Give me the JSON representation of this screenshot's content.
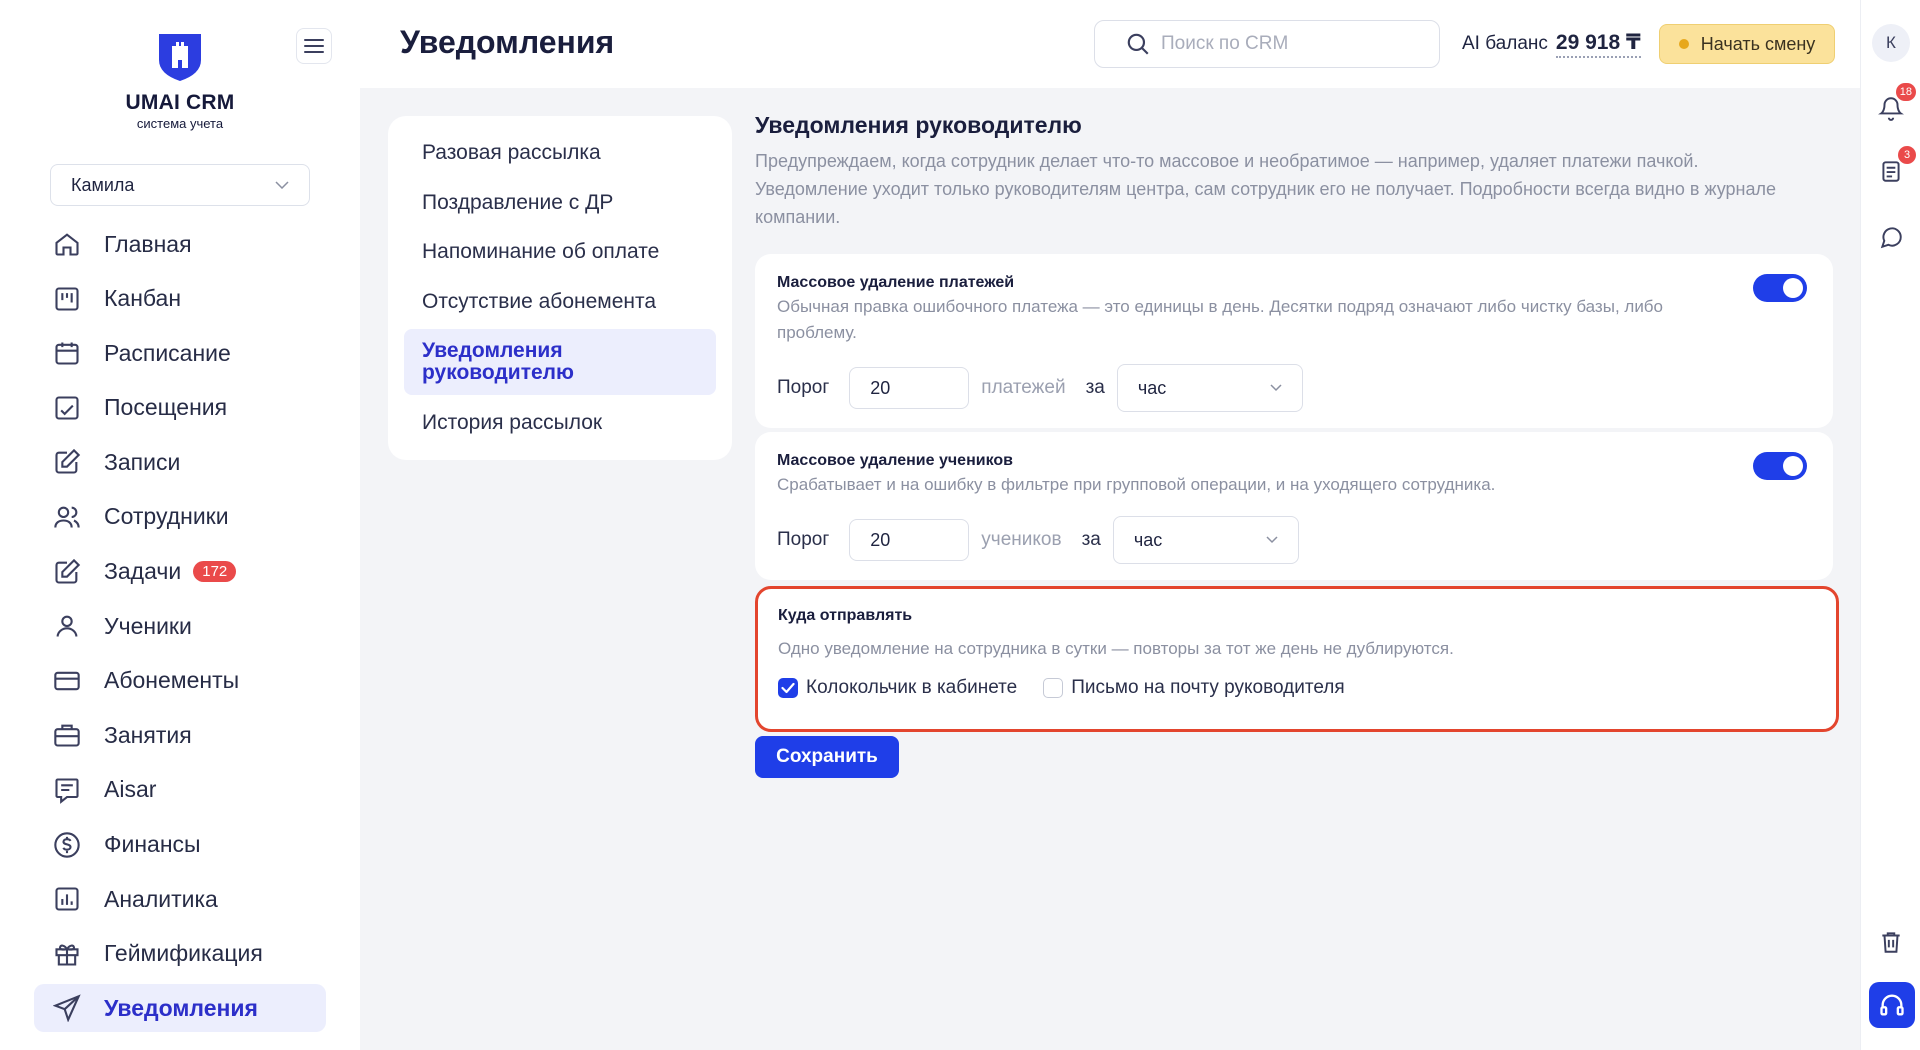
{
  "brand": {
    "title": "UMAI CRM",
    "subtitle": "система учета"
  },
  "branch_select": {
    "value": "Камила"
  },
  "nav": {
    "items": [
      {
        "label": "Главная",
        "icon": "home-icon"
      },
      {
        "label": "Канбан",
        "icon": "kanban-icon"
      },
      {
        "label": "Расписание",
        "icon": "calendar-icon"
      },
      {
        "label": "Посещения",
        "icon": "chart-check-icon"
      },
      {
        "label": "Записи",
        "icon": "edit-icon"
      },
      {
        "label": "Сотрудники",
        "icon": "users-icon"
      },
      {
        "label": "Задачи",
        "icon": "task-icon",
        "badge": "172"
      },
      {
        "label": "Ученики",
        "icon": "user-icon"
      },
      {
        "label": "Абонементы",
        "icon": "card-icon"
      },
      {
        "label": "Занятия",
        "icon": "briefcase-icon"
      },
      {
        "label": "Aisar",
        "icon": "message-icon"
      },
      {
        "label": "Финансы",
        "icon": "dollar-icon"
      },
      {
        "label": "Аналитика",
        "icon": "analytics-icon"
      },
      {
        "label": "Геймификация",
        "icon": "gift-icon"
      },
      {
        "label": "Уведомления",
        "icon": "send-icon",
        "active": true
      }
    ]
  },
  "header": {
    "title": "Уведомления",
    "search_placeholder": "Поиск по CRM",
    "ai_balance_label": "AI баланс",
    "ai_balance_value": "29 918 ₸",
    "shift_button": "Начать смену"
  },
  "rail": {
    "avatar_letter": "К",
    "bell_badge": "18",
    "docs_badge": "3"
  },
  "submenu": {
    "items": [
      "Разовая рассылка",
      "Поздравление с ДР",
      "Напоминание об оплате",
      "Отсутствие абонемента",
      "Уведомления руководителю",
      "История рассылок"
    ]
  },
  "section": {
    "title": "Уведомления руководителю",
    "description": "Предупреждаем, когда сотрудник делает что-то массовое и необратимое — например, удаляет платежи пачкой. Уведомление уходит только руководителям центра, сам сотрудник его не получает. Подробности всегда видно в журнале компании."
  },
  "payments_card": {
    "title": "Массовое удаление платежей",
    "subtitle": "Обычная правка ошибочного платежа — это единицы в день. Десятки подряд означают либо чистку базы, либо проблему.",
    "enabled": true,
    "threshold_label": "Порог",
    "threshold_value": "20",
    "unit": "платежей",
    "per_label": "за",
    "period": "час"
  },
  "students_card": {
    "title": "Массовое удаление учеников",
    "subtitle": "Срабатывает и на ошибку в фильтре при групповой операции, и на уходящего сотрудника.",
    "enabled": true,
    "threshold_label": "Порог",
    "threshold_value": "20",
    "unit": "учеников",
    "per_label": "за",
    "period": "час"
  },
  "destination": {
    "title": "Куда отправлять",
    "subtitle": "Одно уведомление на сотрудника в сутки — повторы за тот же день не дублируются.",
    "bell_label": "Колокольчик в кабинете",
    "bell_checked": true,
    "email_label": "Письмо на почту руководителя",
    "email_checked": false
  },
  "save_button": "Сохранить",
  "colors": {
    "accent": "#1f3ee8",
    "active_bg": "#eceefd",
    "highlight_border": "#e3452e",
    "shift_bg": "#fbe29b",
    "badge": "#ea4a4a"
  }
}
